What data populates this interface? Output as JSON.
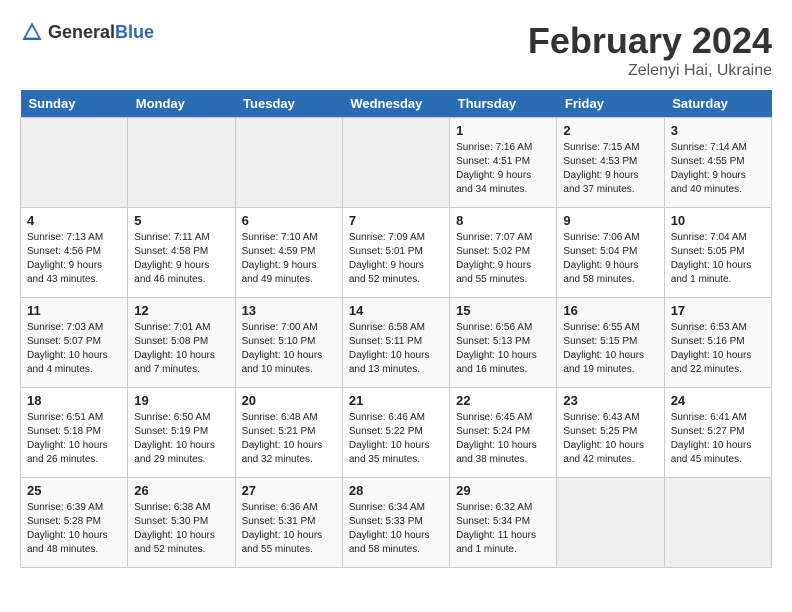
{
  "header": {
    "logo_general": "General",
    "logo_blue": "Blue",
    "month_title": "February 2024",
    "location": "Zelenyi Hai, Ukraine"
  },
  "days_of_week": [
    "Sunday",
    "Monday",
    "Tuesday",
    "Wednesday",
    "Thursday",
    "Friday",
    "Saturday"
  ],
  "weeks": [
    [
      {
        "day": "",
        "empty": true
      },
      {
        "day": "",
        "empty": true
      },
      {
        "day": "",
        "empty": true
      },
      {
        "day": "",
        "empty": true
      },
      {
        "day": "1",
        "sunrise": "7:16 AM",
        "sunset": "4:51 PM",
        "daylight": "9 hours and 34 minutes."
      },
      {
        "day": "2",
        "sunrise": "7:15 AM",
        "sunset": "4:53 PM",
        "daylight": "9 hours and 37 minutes."
      },
      {
        "day": "3",
        "sunrise": "7:14 AM",
        "sunset": "4:55 PM",
        "daylight": "9 hours and 40 minutes."
      }
    ],
    [
      {
        "day": "4",
        "sunrise": "7:13 AM",
        "sunset": "4:56 PM",
        "daylight": "9 hours and 43 minutes."
      },
      {
        "day": "5",
        "sunrise": "7:11 AM",
        "sunset": "4:58 PM",
        "daylight": "9 hours and 46 minutes."
      },
      {
        "day": "6",
        "sunrise": "7:10 AM",
        "sunset": "4:59 PM",
        "daylight": "9 hours and 49 minutes."
      },
      {
        "day": "7",
        "sunrise": "7:09 AM",
        "sunset": "5:01 PM",
        "daylight": "9 hours and 52 minutes."
      },
      {
        "day": "8",
        "sunrise": "7:07 AM",
        "sunset": "5:02 PM",
        "daylight": "9 hours and 55 minutes."
      },
      {
        "day": "9",
        "sunrise": "7:06 AM",
        "sunset": "5:04 PM",
        "daylight": "9 hours and 58 minutes."
      },
      {
        "day": "10",
        "sunrise": "7:04 AM",
        "sunset": "5:05 PM",
        "daylight": "10 hours and 1 minute."
      }
    ],
    [
      {
        "day": "11",
        "sunrise": "7:03 AM",
        "sunset": "5:07 PM",
        "daylight": "10 hours and 4 minutes."
      },
      {
        "day": "12",
        "sunrise": "7:01 AM",
        "sunset": "5:08 PM",
        "daylight": "10 hours and 7 minutes."
      },
      {
        "day": "13",
        "sunrise": "7:00 AM",
        "sunset": "5:10 PM",
        "daylight": "10 hours and 10 minutes."
      },
      {
        "day": "14",
        "sunrise": "6:58 AM",
        "sunset": "5:11 PM",
        "daylight": "10 hours and 13 minutes."
      },
      {
        "day": "15",
        "sunrise": "6:56 AM",
        "sunset": "5:13 PM",
        "daylight": "10 hours and 16 minutes."
      },
      {
        "day": "16",
        "sunrise": "6:55 AM",
        "sunset": "5:15 PM",
        "daylight": "10 hours and 19 minutes."
      },
      {
        "day": "17",
        "sunrise": "6:53 AM",
        "sunset": "5:16 PM",
        "daylight": "10 hours and 22 minutes."
      }
    ],
    [
      {
        "day": "18",
        "sunrise": "6:51 AM",
        "sunset": "5:18 PM",
        "daylight": "10 hours and 26 minutes."
      },
      {
        "day": "19",
        "sunrise": "6:50 AM",
        "sunset": "5:19 PM",
        "daylight": "10 hours and 29 minutes."
      },
      {
        "day": "20",
        "sunrise": "6:48 AM",
        "sunset": "5:21 PM",
        "daylight": "10 hours and 32 minutes."
      },
      {
        "day": "21",
        "sunrise": "6:46 AM",
        "sunset": "5:22 PM",
        "daylight": "10 hours and 35 minutes."
      },
      {
        "day": "22",
        "sunrise": "6:45 AM",
        "sunset": "5:24 PM",
        "daylight": "10 hours and 38 minutes."
      },
      {
        "day": "23",
        "sunrise": "6:43 AM",
        "sunset": "5:25 PM",
        "daylight": "10 hours and 42 minutes."
      },
      {
        "day": "24",
        "sunrise": "6:41 AM",
        "sunset": "5:27 PM",
        "daylight": "10 hours and 45 minutes."
      }
    ],
    [
      {
        "day": "25",
        "sunrise": "6:39 AM",
        "sunset": "5:28 PM",
        "daylight": "10 hours and 48 minutes."
      },
      {
        "day": "26",
        "sunrise": "6:38 AM",
        "sunset": "5:30 PM",
        "daylight": "10 hours and 52 minutes."
      },
      {
        "day": "27",
        "sunrise": "6:36 AM",
        "sunset": "5:31 PM",
        "daylight": "10 hours and 55 minutes."
      },
      {
        "day": "28",
        "sunrise": "6:34 AM",
        "sunset": "5:33 PM",
        "daylight": "10 hours and 58 minutes."
      },
      {
        "day": "29",
        "sunrise": "6:32 AM",
        "sunset": "5:34 PM",
        "daylight": "11 hours and 1 minute."
      },
      {
        "day": "",
        "empty": true
      },
      {
        "day": "",
        "empty": true
      }
    ]
  ]
}
